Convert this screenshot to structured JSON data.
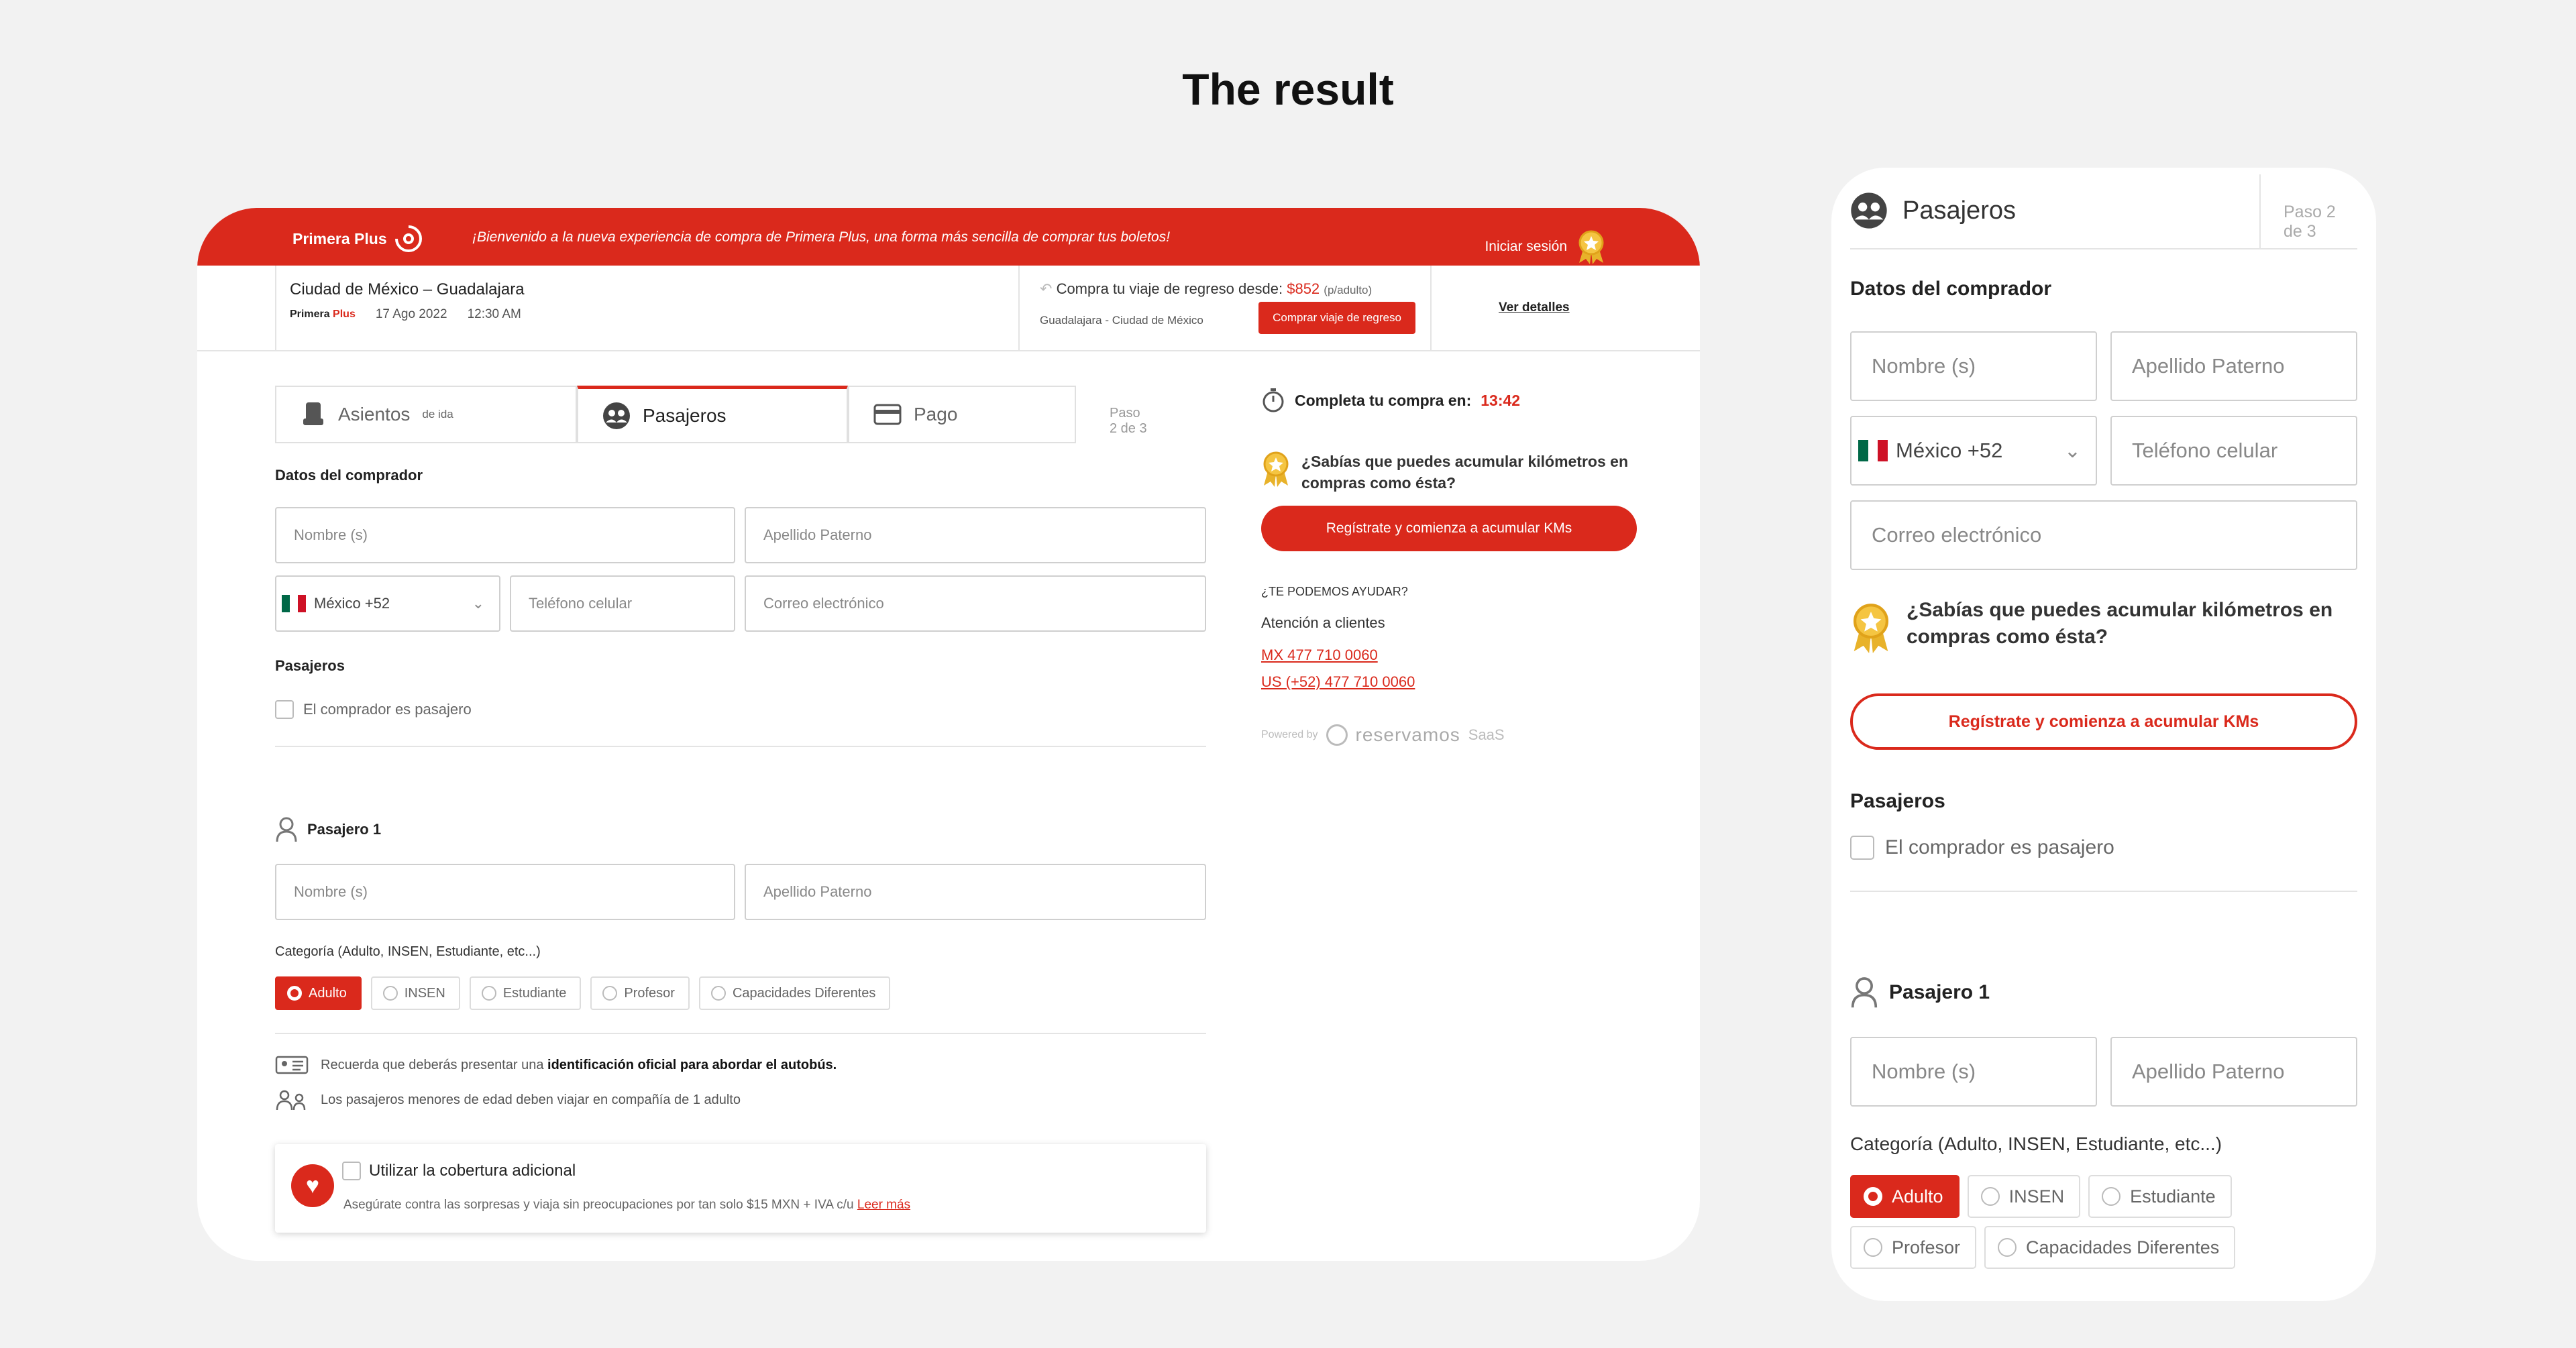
{
  "heading": "The result",
  "colors": {
    "accent": "#da291c",
    "medal": "#e8b22a",
    "background": "#f2f2f2"
  },
  "desktop": {
    "topbar": {
      "logo": "Primera Plus",
      "welcome": "¡Bienvenido a la nueva experiencia de compra de Primera Plus, una forma más sencilla de comprar tus boletos!",
      "login": "Iniciar sesión"
    },
    "trip": {
      "route": "Ciudad de México – Guadalajara",
      "logo_small_a": "Primera",
      "logo_small_b": "Plus",
      "date": "17 Ago 2022",
      "time": "12:30 AM"
    },
    "return": {
      "prefix": "Compra tu viaje de regreso desde:",
      "price": "$852",
      "unit": "(p/adulto)",
      "route": "Guadalajara - Ciudad de México",
      "button": "Comprar viaje de regreso"
    },
    "details_link": "Ver detalles",
    "tabs": {
      "seats": "Asientos",
      "seats_sub": "de ida",
      "passengers": "Pasajeros",
      "payment": "Pago",
      "step": "Paso 2 de 3"
    },
    "buyer": {
      "title": "Datos del comprador",
      "name_placeholder": "Nombre (s)",
      "surname_placeholder": "Apellido Paterno",
      "country": "México +52",
      "phone_placeholder": "Teléfono celular",
      "email_placeholder": "Correo electrónico"
    },
    "passengers_section": {
      "title": "Pasajeros",
      "buyer_is_passenger": "El comprador es pasajero"
    },
    "passenger1": {
      "title": "Pasajero 1",
      "name_placeholder": "Nombre (s)",
      "surname_placeholder": "Apellido Paterno",
      "category_label": "Categoría (Adulto, INSEN, Estudiante, etc...)",
      "categories": [
        "Adulto",
        "INSEN",
        "Estudiante",
        "Profesor",
        "Capacidades Diferentes"
      ],
      "selected": "Adulto"
    },
    "notes": {
      "id_prefix": "Recuerda que deberás presentar una",
      "id_bold": "identificación oficial para abordar el autobús.",
      "minors": "Los pasajeros menores de edad deben viajar en compañía de 1 adulto"
    },
    "coverage": {
      "label": "Utilizar la cobertura adicional",
      "desc": "Asegúrate contra las sorpresas y viaja sin preocupaciones por tan solo $15 MXN + IVA c/u",
      "link": "Leer más"
    },
    "side": {
      "timer_label": "Completa tu compra en:",
      "timer_value": "13:42",
      "kms_question": "¿Sabías que puedes acumular kilómetros en compras como ésta?",
      "kms_button": "Regístrate y comienza a acumular KMs",
      "help_heading": "¿TE PODEMOS AYUDAR?",
      "help_sub": "Atención a clientes",
      "phone_mx": "MX 477 710 0060",
      "phone_us": "US (+52) 477 710 0060",
      "powered_by": "Powered by",
      "powered_brand": "reservamos",
      "powered_suffix": "SaaS"
    }
  },
  "mobile": {
    "title": "Pasajeros",
    "step": "Paso 2 de 3",
    "buyer_title": "Datos del comprador",
    "name_placeholder": "Nombre (s)",
    "surname_placeholder": "Apellido Paterno",
    "country": "México +52",
    "phone_placeholder": "Teléfono celular",
    "email_placeholder": "Correo electrónico",
    "kms_question": "¿Sabías que puedes acumular kilómetros en compras como ésta?",
    "kms_button": "Regístrate y comienza a acumular KMs",
    "passengers_title": "Pasajeros",
    "buyer_is_passenger": "El comprador es pasajero",
    "passenger1_title": "Pasajero 1",
    "p1_name_placeholder": "Nombre (s)",
    "p1_surname_placeholder": "Apellido Paterno",
    "category_label": "Categoría (Adulto, INSEN, Estudiante, etc...)",
    "categories": [
      "Adulto",
      "INSEN",
      "Estudiante",
      "Profesor",
      "Capacidades Diferentes"
    ],
    "selected": "Adulto"
  }
}
